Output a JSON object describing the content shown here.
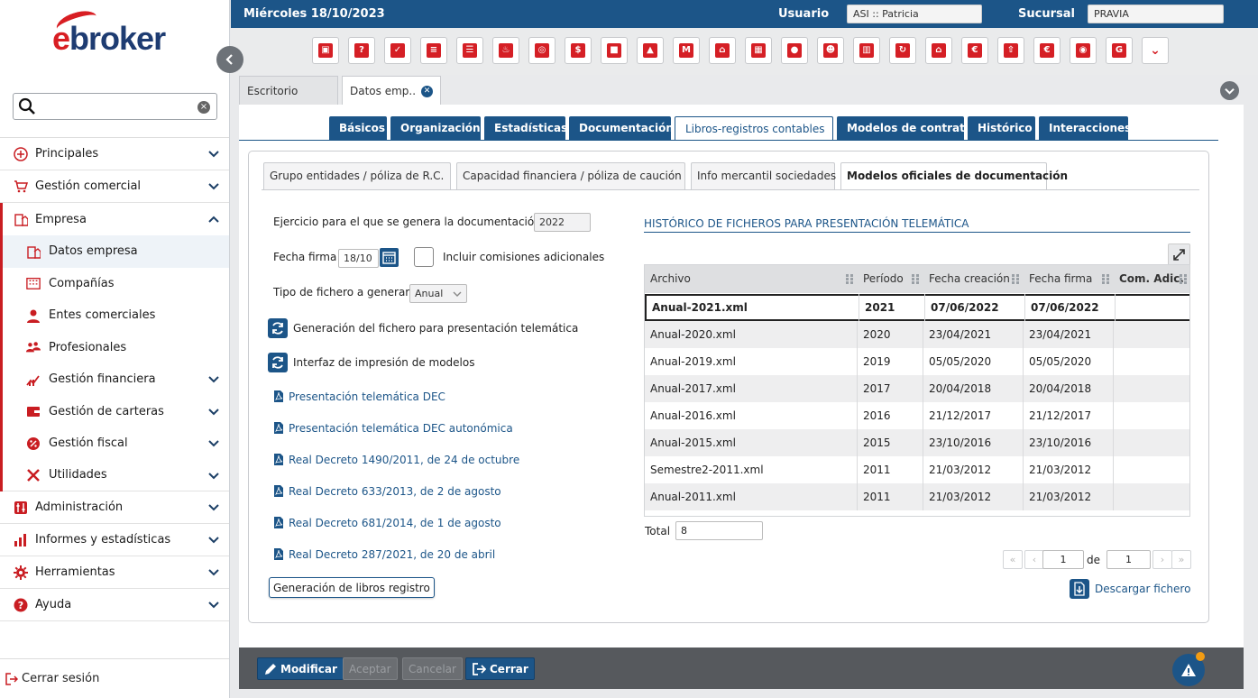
{
  "app": {
    "logo": "ebroker"
  },
  "topbar": {
    "date": "Miércoles 18/10/2023",
    "user_label": "Usuario",
    "user_value": "ASI :: Patricia",
    "branch_label": "Sucursal",
    "branch_value": "PRAVIA"
  },
  "toolbar_icons": [
    "cube-icon",
    "user-question-icon",
    "user-check-icon",
    "document-icon",
    "list-icon",
    "flame-icon",
    "target-icon",
    "money-icon",
    "briefcase-icon",
    "bag-icon",
    "m-brand-icon",
    "house-doc-icon",
    "building-icon",
    "person-icon",
    "group-icon",
    "buildings-icon",
    "cycle-icon",
    "house-people-icon",
    "euro-icon",
    "house-arrow-icon",
    "shield-euro-icon",
    "eye-swirl-icon",
    "g-brand-icon",
    "chevron-down-icon"
  ],
  "search": {
    "placeholder": "",
    "clear": "×"
  },
  "sidebar": {
    "items": [
      {
        "label": "Principales"
      },
      {
        "label": "Gestión comercial"
      },
      {
        "label": "Empresa"
      },
      {
        "label": "Datos empresa"
      },
      {
        "label": "Compañías"
      },
      {
        "label": "Entes comerciales"
      },
      {
        "label": "Profesionales"
      },
      {
        "label": "Gestión financiera"
      },
      {
        "label": "Gestión de carteras"
      },
      {
        "label": "Gestión fiscal"
      },
      {
        "label": "Utilidades"
      },
      {
        "label": "Administración"
      },
      {
        "label": "Informes y estadísticas"
      },
      {
        "label": "Herramientas"
      },
      {
        "label": "Ayuda"
      }
    ],
    "logout": "Cerrar sesión"
  },
  "doc_tabs": [
    {
      "label": "Escritorio"
    },
    {
      "label": "Datos emp.."
    }
  ],
  "section_tabs": [
    "Básicos",
    "Organización",
    "Estadísticas",
    "Documentación",
    "Libros-registros contables",
    "Modelos de contrato",
    "Histórico",
    "Interacciones"
  ],
  "sub_tabs": [
    "Grupo entidades / póliza de R.C.",
    "Capacidad financiera / póliza de caución",
    "Info mercantil sociedades",
    "Modelos oficiales de documentación"
  ],
  "form": {
    "ejercicio_label": "Ejercicio para el que se genera la documentación",
    "ejercicio_value": "2022",
    "fecha_label": "Fecha firma",
    "fecha_value": "18/10",
    "comisiones_label": "Incluir comisiones adicionales",
    "tipo_label": "Tipo de fichero a generar",
    "tipo_value": "Anual",
    "gen_telematica": "Generación del fichero para presentación telemática",
    "interfaz_impresion": "Interfaz de impresión de modelos",
    "links": [
      "Presentación telemática DEC",
      "Presentación telemática DEC autonómica",
      "Real Decreto 1490/2011, de 24 de octubre",
      "Real Decreto 633/2013, de 2 de agosto",
      "Real Decreto 681/2014, de 1 de agosto",
      "Real Decreto 287/2021, de 20 de abril"
    ],
    "gen_libros": "Generación de libros registro"
  },
  "historico": {
    "title": "HISTÓRICO DE FICHEROS PARA PRESENTACIÓN TELEMÁTICA",
    "columns": [
      "Archivo",
      "Período",
      "Fecha creación",
      "Fecha firma",
      "Com. Adic."
    ],
    "rows": [
      [
        "Anual-2021.xml",
        "2021",
        "07/06/2022",
        "07/06/2022",
        ""
      ],
      [
        "Anual-2020.xml",
        "2020",
        "23/04/2021",
        "23/04/2021",
        ""
      ],
      [
        "Anual-2019.xml",
        "2019",
        "05/05/2020",
        "05/05/2020",
        ""
      ],
      [
        "Anual-2017.xml",
        "2017",
        "20/04/2018",
        "20/04/2018",
        ""
      ],
      [
        "Anual-2016.xml",
        "2016",
        "21/12/2017",
        "21/12/2017",
        ""
      ],
      [
        "Anual-2015.xml",
        "2015",
        "23/10/2016",
        "23/10/2016",
        ""
      ],
      [
        "Semestre2-2011.xml",
        "2011",
        "21/03/2012",
        "21/03/2012",
        ""
      ],
      [
        "Anual-2011.xml",
        "2011",
        "21/03/2012",
        "21/03/2012",
        ""
      ]
    ],
    "total_label": "Total",
    "total_value": "8",
    "page": "1",
    "page_sep": "de",
    "page_total": "1",
    "download": "Descargar fichero"
  },
  "footer": {
    "modificar": "Modificar",
    "aceptar": "Aceptar",
    "cancelar": "Cancelar",
    "cerrar": "Cerrar"
  },
  "colors": {
    "brand_blue": "#1c5588",
    "brand_red": "#d51f25",
    "alert_dot": "#f39c12"
  }
}
